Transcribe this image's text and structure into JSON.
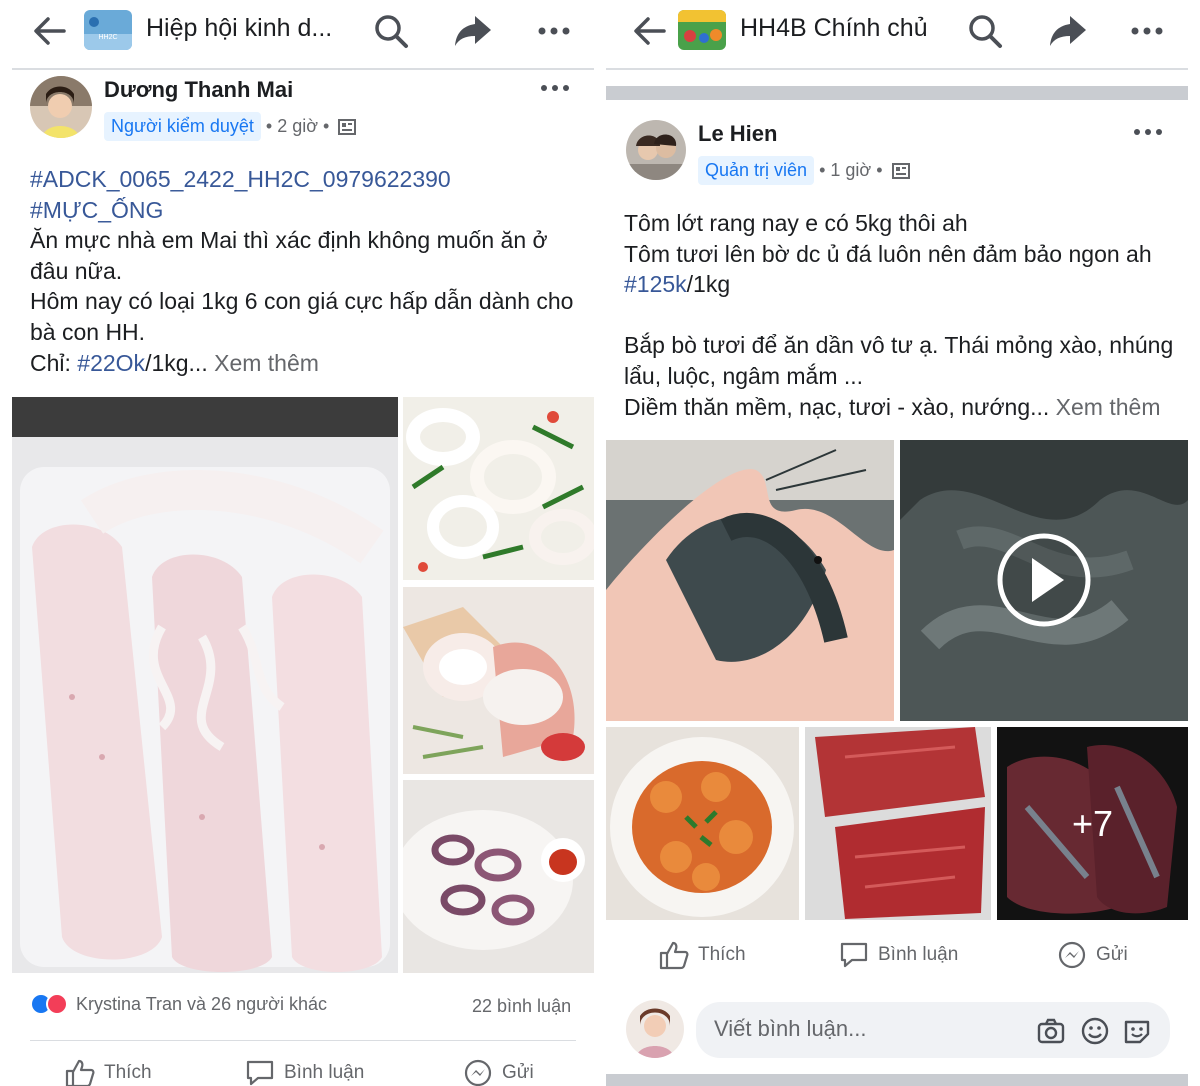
{
  "left": {
    "topbar": {
      "group_title": "Hiệp hội kinh d...",
      "group_icon_text": "HH2C"
    },
    "post": {
      "author": "Dương Thanh Mai",
      "role": "Người kiểm duyệt",
      "time": "2 giờ",
      "hashtag1": "#ADCK_0065_2422_HH2C_0979622390",
      "hashtag2": "#MỰC_ỐNG",
      "line1": "Ăn mực nhà em Mai thì xác định không muốn ăn ở đâu nữa.",
      "line2": "Hôm nay có loại 1kg 6 con giá cực hấp dẫn dành cho bà con HH.",
      "price_prefix": "Chỉ: ",
      "price_tag": "#22Ok",
      "price_suffix": "/1kg...",
      "see_more": "Xem thêm",
      "reactions_text": "Krystina Tran và 26 người khác",
      "comments_count": "22 bình luận",
      "actions": {
        "like": "Thích",
        "comment": "Bình luận",
        "share": "Gửi"
      }
    }
  },
  "right": {
    "topbar": {
      "group_title": "HH4B Chính chủ"
    },
    "post": {
      "author": "Le Hien",
      "role": "Quản trị viên",
      "time": "1 giờ",
      "p1_line1": "Tôm lớt rang nay e có 5kg thôi ah",
      "p1_line2": "Tôm tươi lên bờ dc ủ đá luôn nên đảm bảo ngon ah",
      "p1_tag": "#125k",
      "p1_tag_suffix": "/1kg",
      "p2_line1": "Bắp bò tươi để ăn dần vô tư ạ. Thái mỏng xào, nhúng lẩu, luộc, ngâm mắm ...",
      "p2_line2": "Diềm thăn mềm, nạc, tươi - xào, nướng...",
      "see_more": "Xem thêm",
      "more_photos": "+7",
      "actions": {
        "like": "Thích",
        "comment": "Bình luận",
        "share": "Gửi"
      },
      "comment_placeholder": "Viết bình luận..."
    }
  },
  "colors": {
    "link": "#385898",
    "badge_bg": "#e7f3ff",
    "badge_text": "#1877f2",
    "muted": "#65676b",
    "like_blue": "#1877f2",
    "love_red": "#f33e58"
  }
}
